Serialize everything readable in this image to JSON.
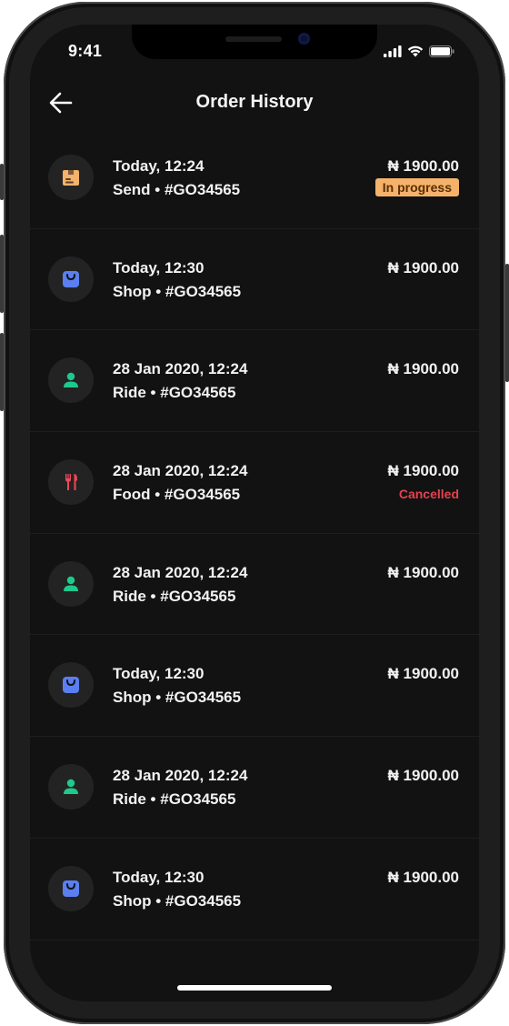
{
  "status_bar": {
    "time": "9:41"
  },
  "header": {
    "title": "Order History"
  },
  "colors": {
    "send": "#f5b26b",
    "shop": "#5b7ff0",
    "ride": "#1ec98d",
    "food": "#ea4a5a",
    "in_progress_bg": "#f5b26b",
    "cancelled": "#e5414f"
  },
  "orders": [
    {
      "icon": "package-icon",
      "type": "send",
      "when": "Today, 12:24",
      "ref": "Send • #GO34565",
      "amount": "₦ 1900.00",
      "status": "In progress"
    },
    {
      "icon": "shopping-bag-icon",
      "type": "shop",
      "when": "Today, 12:30",
      "ref": "Shop • #GO34565",
      "amount": "₦ 1900.00",
      "status": ""
    },
    {
      "icon": "person-icon",
      "type": "ride",
      "when": "28 Jan 2020, 12:24",
      "ref": "Ride • #GO34565",
      "amount": "₦ 1900.00",
      "status": ""
    },
    {
      "icon": "fork-knife-icon",
      "type": "food",
      "when": "28 Jan 2020, 12:24",
      "ref": "Food • #GO34565",
      "amount": "₦ 1900.00",
      "status": "Cancelled"
    },
    {
      "icon": "person-icon",
      "type": "ride",
      "when": "28 Jan 2020, 12:24",
      "ref": "Ride • #GO34565",
      "amount": "₦ 1900.00",
      "status": ""
    },
    {
      "icon": "shopping-bag-icon",
      "type": "shop",
      "when": "Today, 12:30",
      "ref": "Shop • #GO34565",
      "amount": "₦ 1900.00",
      "status": ""
    },
    {
      "icon": "person-icon",
      "type": "ride",
      "when": "28 Jan 2020, 12:24",
      "ref": "Ride • #GO34565",
      "amount": "₦ 1900.00",
      "status": ""
    },
    {
      "icon": "shopping-bag-icon",
      "type": "shop",
      "when": "Today, 12:30",
      "ref": "Shop • #GO34565",
      "amount": "₦ 1900.00",
      "status": ""
    }
  ]
}
